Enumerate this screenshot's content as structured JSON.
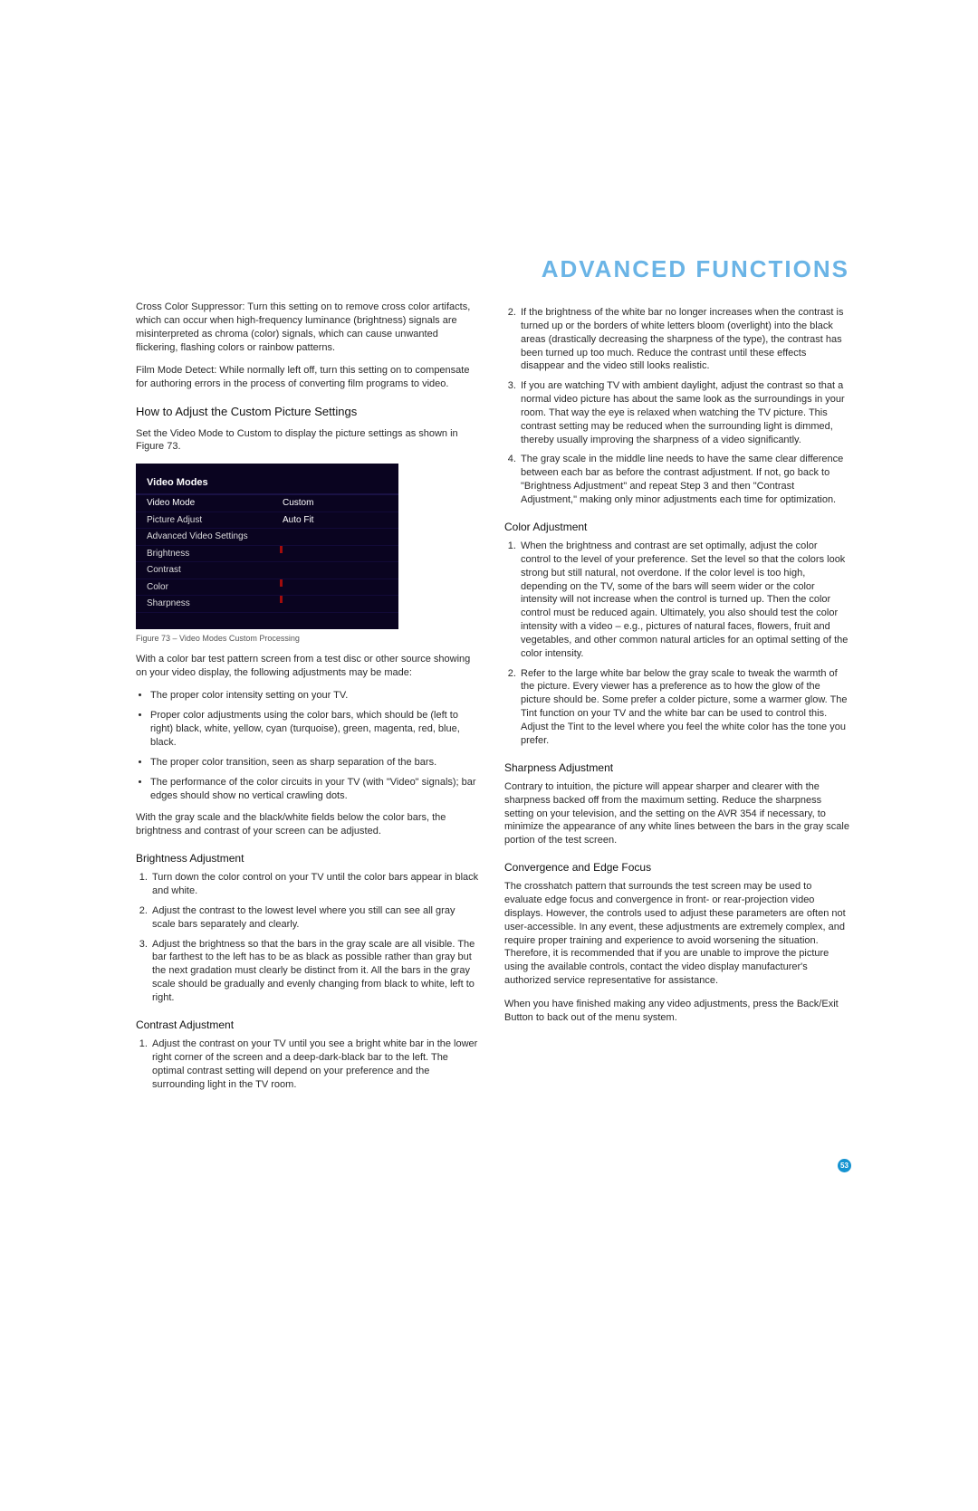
{
  "title": "ADVANCED FUNCTIONS",
  "page_number": "53",
  "left": {
    "cross_color": {
      "lead": "Cross Color Suppressor:",
      "text": " Turn this setting on to remove cross color artifacts, which can occur when high-frequency luminance (brightness) signals are misinterpreted as chroma (color) signals, which can cause unwanted flickering, flashing colors or rainbow patterns."
    },
    "film_mode": {
      "lead": "Film Mode Detect:",
      "text": " While normally left off, turn this setting on to compensate for authoring errors in the process of converting film programs to video."
    },
    "h2_custom": "How to Adjust the Custom Picture Settings",
    "custom_intro": "Set the Video Mode to Custom to display the picture settings as shown in Figure 73.",
    "fig": {
      "header": "Video Modes",
      "row_mode_l": "Video Mode",
      "row_mode_r": "Custom",
      "row_pa_l": "Picture Adjust",
      "row_pa_r": "Auto Fit",
      "row_avs": "Advanced Video Settings",
      "row_brightness": "Brightness",
      "row_contrast": "Contrast",
      "row_color": "Color",
      "row_sharpness": "Sharpness",
      "caption": "Figure 73 – Video Modes Custom Processing"
    },
    "after_fig": "With a color bar test pattern screen from a test disc or other source showing on your video display, the following adjustments may be made:",
    "bullets": {
      "b1": "The proper color intensity setting on your TV.",
      "b2": "Proper color adjustments using the color bars, which should be (left to right) black, white, yellow, cyan (turquoise), green, magenta, red, blue, black.",
      "b3": "The proper color transition, seen as sharp separation of the bars.",
      "b4": "The performance of the color circuits in your TV (with \"Video\" signals); bar edges should show no vertical crawling dots."
    },
    "gray_intro": "With the gray scale and the black/white fields below the color bars, the brightness and contrast of your screen can be adjusted.",
    "h3_brightness": "Brightness Adjustment",
    "brightness": {
      "n1": "Turn down the color control on your TV until the color bars appear in black and white.",
      "n2": "Adjust the contrast to the lowest level where you still can see all gray scale bars separately and clearly.",
      "n3": "Adjust the brightness so that the bars in the gray scale are all visible. The bar farthest to the left has to be as black as possible rather than gray but the next gradation must clearly be distinct from it. All the bars in the gray scale should be gradually and evenly changing from black to white, left to right."
    },
    "h3_contrast": "Contrast Adjustment",
    "contrast": {
      "n1": "Adjust the contrast on your TV until you see a bright white bar in the lower right corner of the screen and a deep-dark-black bar to the left. The optimal contrast setting will depend on your preference and the surrounding light in the TV room."
    }
  },
  "right": {
    "contrast_cont": {
      "n2": "If the brightness of the white bar no longer increases when the contrast is turned up or the borders of white letters bloom (overlight) into the black areas (drastically decreasing the sharpness of the type), the contrast has been turned up too much. Reduce the contrast until these effects disappear and the video still looks realistic.",
      "n3": "If you are watching TV with ambient daylight, adjust the contrast so that a normal video picture has about the same look as the surroundings in your room. That way the eye is relaxed when watching the TV picture. This contrast setting may be reduced when the surrounding light is dimmed, thereby usually improving the sharpness of a video significantly.",
      "n4": "The gray scale in the middle line needs to have the same clear difference between each bar as before the contrast adjustment. If not, go back to \"Brightness Adjustment\" and repeat Step 3 and then \"Contrast Adjustment,\" making only minor adjustments each time for optimization."
    },
    "h3_color": "Color Adjustment",
    "color": {
      "n1": "When the brightness and contrast are set optimally, adjust the color control to the level of your preference. Set the level so that the colors look strong but still natural, not overdone. If the color level is too high, depending on the TV, some of the bars will seem wider or the color intensity will not increase when the control is turned up. Then the color control must be reduced again. Ultimately, you also should test the color intensity with a video – e.g., pictures of natural faces, flowers, fruit and vegetables, and other common natural articles for an optimal setting of the color intensity.",
      "n2": "Refer to the large white bar below the gray scale to tweak the warmth of the picture. Every viewer has a preference as to how the glow of the picture should be. Some prefer a colder picture, some a warmer glow. The Tint function on your TV and the white bar can be used to control this. Adjust the Tint to the level where you feel the white color has the tone you prefer."
    },
    "h3_sharp": "Sharpness Adjustment",
    "sharp_text": "Contrary to intuition, the picture will appear sharper and clearer with the sharpness backed off from the maximum setting. Reduce the sharpness setting on your television, and the setting on the AVR 354 if necessary, to minimize the appearance of any white lines between the bars in the gray scale portion of the test screen.",
    "h3_conv": "Convergence and Edge Focus",
    "conv_p1": "The crosshatch pattern that surrounds the test screen may be used to evaluate edge focus and convergence in front- or rear-projection video displays. However, the controls used to adjust these parameters are often not user-accessible. In any event, these adjustments are extremely complex, and require proper training and experience to avoid worsening the situation. Therefore, it is recommended that if you are unable to improve the picture using the available controls, contact the video display manufacturer's authorized service representative for assistance.",
    "conv_p2": "When you have finished making any video adjustments, press the Back/Exit Button to back out of the menu system."
  }
}
